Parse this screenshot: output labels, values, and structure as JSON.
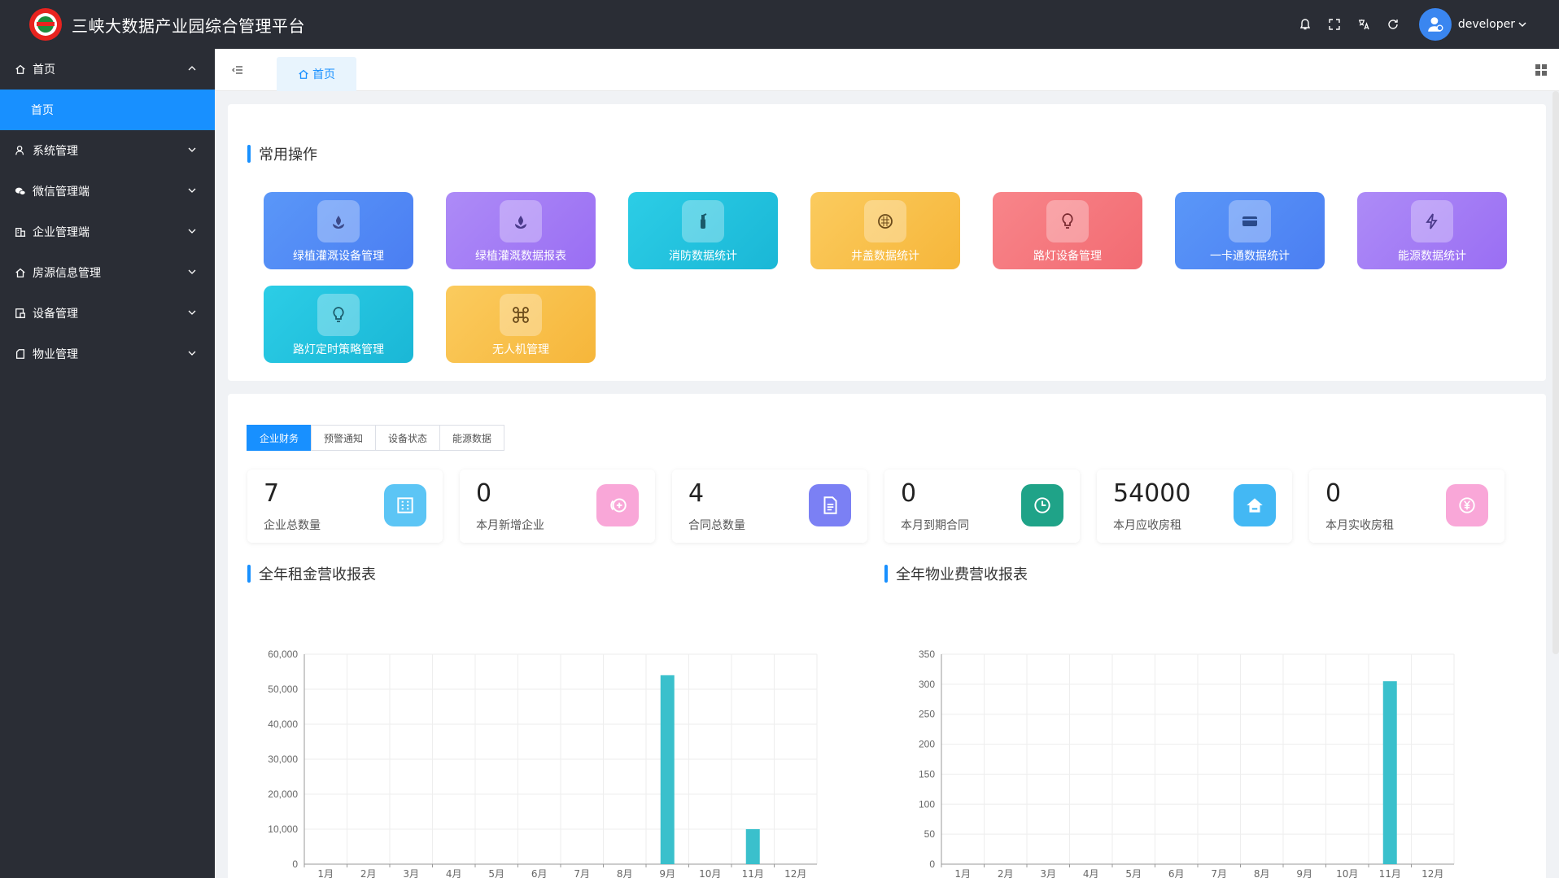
{
  "app": {
    "title": "三峡大数据产业园综合管理平台"
  },
  "header": {
    "user_name": "developer"
  },
  "sidebar": {
    "items": [
      {
        "label": "首页",
        "icon": "home-icon",
        "expanded": true,
        "children": [
          {
            "label": "首页",
            "active": true
          }
        ]
      },
      {
        "label": "系统管理",
        "icon": "user-icon"
      },
      {
        "label": "微信管理端",
        "icon": "wechat-icon"
      },
      {
        "label": "企业管理端",
        "icon": "enterprise-icon"
      },
      {
        "label": "房源信息管理",
        "icon": "house-icon"
      },
      {
        "label": "设备管理",
        "icon": "device-icon"
      },
      {
        "label": "物业管理",
        "icon": "property-icon"
      }
    ]
  },
  "tabs": {
    "active_tab": "首页"
  },
  "common_ops": {
    "title": "常用操作",
    "tiles": [
      {
        "label": "绿植灌溉设备管理",
        "icon": "plant-icon",
        "color": "#4e8ef7"
      },
      {
        "label": "绿植灌溉数据报表",
        "icon": "plant-icon",
        "color": "#a27cf5"
      },
      {
        "label": "消防数据统计",
        "icon": "extinguisher-icon",
        "color": "#22c2de"
      },
      {
        "label": "井盖数据统计",
        "icon": "manhole-icon",
        "color": "#f8c14a"
      },
      {
        "label": "路灯设备管理",
        "icon": "bulb-icon",
        "color": "#f6787e"
      },
      {
        "label": "一卡通数据统计",
        "icon": "card-icon",
        "color": "#4e8ef7"
      },
      {
        "label": "能源数据统计",
        "icon": "lightning-icon",
        "color": "#a27cf5"
      },
      {
        "label": "路灯定时策略管理",
        "icon": "bulb-icon",
        "color": "#22c2de"
      },
      {
        "label": "无人机管理",
        "icon": "drone-icon",
        "color": "#f8c14a"
      }
    ]
  },
  "stat_tabs": [
    "企业财务",
    "预警通知",
    "设备状态",
    "能源数据"
  ],
  "stats": [
    {
      "value": "7",
      "label": "企业总数量",
      "icon": "building-icon",
      "color": "#5cc5f5"
    },
    {
      "value": "0",
      "label": "本月新增企业",
      "icon": "add-coin-icon",
      "color": "#f9a7d8"
    },
    {
      "value": "4",
      "label": "合同总数量",
      "icon": "document-icon",
      "color": "#7b80f4"
    },
    {
      "value": "0",
      "label": "本月到期合同",
      "icon": "clock-icon",
      "color": "#1fa388"
    },
    {
      "value": "54000",
      "label": "本月应收房租",
      "icon": "house-icon",
      "color": "#43b8f4"
    },
    {
      "value": "0",
      "label": "本月实收房租",
      "icon": "yen-icon",
      "color": "#f9a7d8"
    }
  ],
  "chart_data": [
    {
      "type": "bar",
      "title": "全年租金营收报表",
      "categories": [
        "1月",
        "2月",
        "3月",
        "4月",
        "5月",
        "6月",
        "7月",
        "8月",
        "9月",
        "10月",
        "11月",
        "12月"
      ],
      "values": [
        0,
        0,
        0,
        0,
        0,
        0,
        0,
        0,
        54000,
        0,
        10000,
        0
      ],
      "ylim": [
        0,
        60000
      ],
      "yticks": [
        "0",
        "10,000",
        "20,000",
        "30,000",
        "40,000",
        "50,000",
        "60,000"
      ],
      "color": "#3ac0cc",
      "grid": true
    },
    {
      "type": "bar",
      "title": "全年物业费营收报表",
      "categories": [
        "1月",
        "2月",
        "3月",
        "4月",
        "5月",
        "6月",
        "7月",
        "8月",
        "9月",
        "10月",
        "11月",
        "12月"
      ],
      "values": [
        0,
        0,
        0,
        0,
        0,
        0,
        0,
        0,
        0,
        0,
        305,
        0
      ],
      "ylim": [
        0,
        350
      ],
      "yticks": [
        "0",
        "50",
        "100",
        "150",
        "200",
        "250",
        "300",
        "350"
      ],
      "color": "#3ac0cc",
      "grid": true
    }
  ]
}
